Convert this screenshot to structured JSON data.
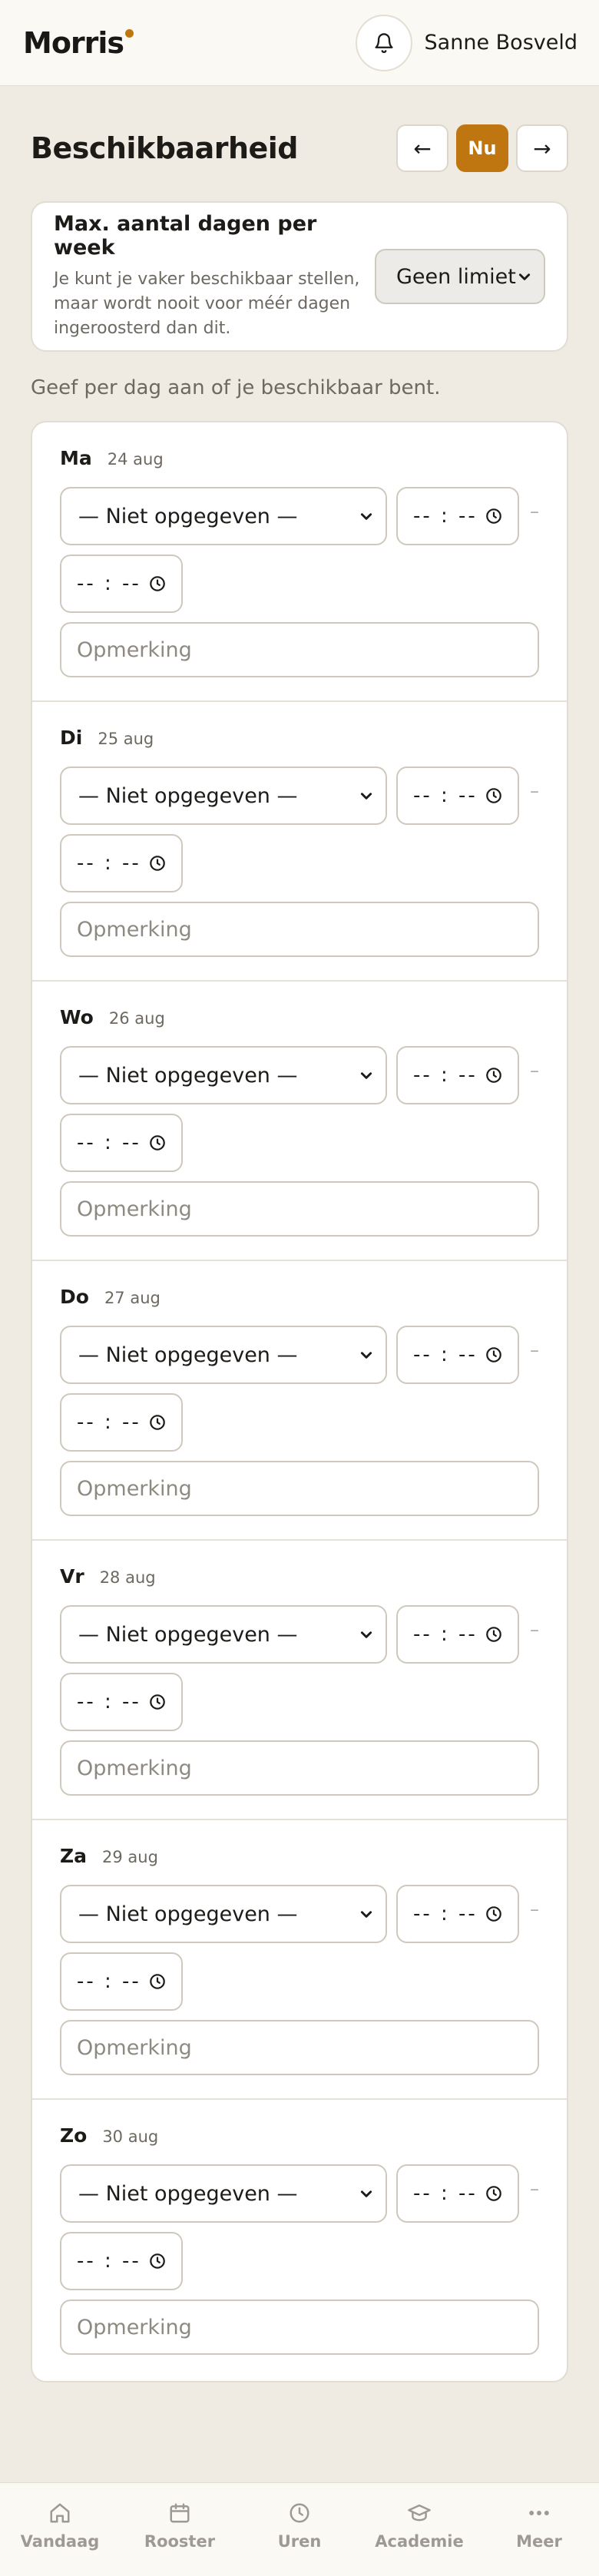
{
  "header": {
    "logo": "Morris",
    "user_name": "Sanne Bosveld"
  },
  "page": {
    "title": "Beschikbaarheid",
    "prev_label": "←",
    "now_label": "Nu",
    "next_label": "→"
  },
  "max_days": {
    "title": "Max. aantal dagen per week",
    "description": "Je kunt je vaker beschikbaar stellen, maar wordt nooit voor méér dagen ingeroosterd dan dit.",
    "selected": "Geen limiet"
  },
  "hint": "Geef per dag aan of je beschikbaar bent.",
  "days": [
    {
      "name": "Ma",
      "date": "24 aug",
      "status": "— Niet opgegeven —",
      "start": "-- : --",
      "end": "-- : --",
      "note_placeholder": "Opmerking"
    },
    {
      "name": "Di",
      "date": "25 aug",
      "status": "— Niet opgegeven —",
      "start": "-- : --",
      "end": "-- : --",
      "note_placeholder": "Opmerking"
    },
    {
      "name": "Wo",
      "date": "26 aug",
      "status": "— Niet opgegeven —",
      "start": "-- : --",
      "end": "-- : --",
      "note_placeholder": "Opmerking"
    },
    {
      "name": "Do",
      "date": "27 aug",
      "status": "— Niet opgegeven —",
      "start": "-- : --",
      "end": "-- : --",
      "note_placeholder": "Opmerking"
    },
    {
      "name": "Vr",
      "date": "28 aug",
      "status": "— Niet opgegeven —",
      "start": "-- : --",
      "end": "-- : --",
      "note_placeholder": "Opmerking"
    },
    {
      "name": "Za",
      "date": "29 aug",
      "status": "— Niet opgegeven —",
      "start": "-- : --",
      "end": "-- : --",
      "note_placeholder": "Opmerking"
    },
    {
      "name": "Zo",
      "date": "30 aug",
      "status": "— Niet opgegeven —",
      "start": "-- : --",
      "end": "-- : --",
      "note_placeholder": "Opmerking"
    }
  ],
  "time_separator": "–",
  "bottom_nav": [
    {
      "label": "Vandaag",
      "icon": "home-icon"
    },
    {
      "label": "Rooster",
      "icon": "calendar-icon"
    },
    {
      "label": "Uren",
      "icon": "clock-icon"
    },
    {
      "label": "Academie",
      "icon": "graduation-cap-icon"
    },
    {
      "label": "Meer",
      "icon": "more-dots-icon"
    }
  ],
  "colors": {
    "accent": "#bf7510",
    "background": "#efebe3",
    "nav_inactive": "#9e9a93"
  }
}
